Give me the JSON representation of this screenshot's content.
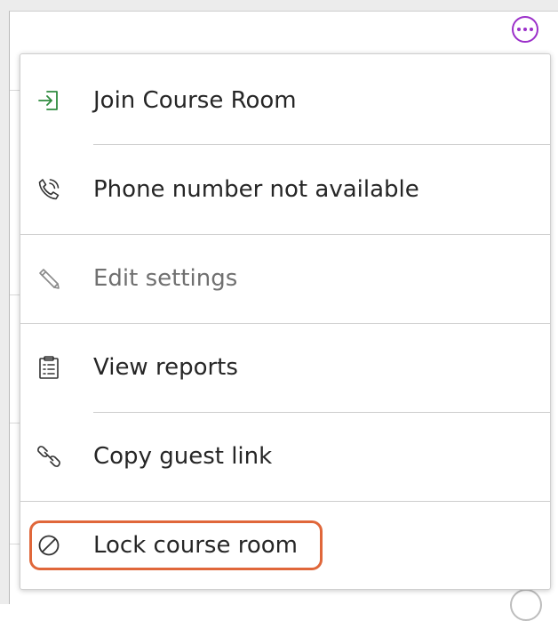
{
  "toolbar": {
    "more_icon": "ellipsis-horizontal-icon"
  },
  "menu": {
    "items": [
      {
        "label": "Join Course Room",
        "icon": "enter-arrow-icon",
        "disabled": false
      },
      {
        "label": "Phone number not available",
        "icon": "phone-icon",
        "disabled": false
      },
      {
        "label": "Edit settings",
        "icon": "pencil-icon",
        "disabled": true
      },
      {
        "label": "View reports",
        "icon": "clipboard-report-icon",
        "disabled": false
      },
      {
        "label": "Copy guest link",
        "icon": "chain-link-icon",
        "disabled": false
      },
      {
        "label": "Lock course room",
        "icon": "prohibited-circle-icon",
        "disabled": false,
        "highlighted": true
      }
    ]
  },
  "colors": {
    "accent_purple": "#9b2fc9",
    "join_green": "#2e8b3e",
    "highlight_orange": "#e0673a",
    "text": "#262626",
    "text_disabled": "#707070"
  }
}
